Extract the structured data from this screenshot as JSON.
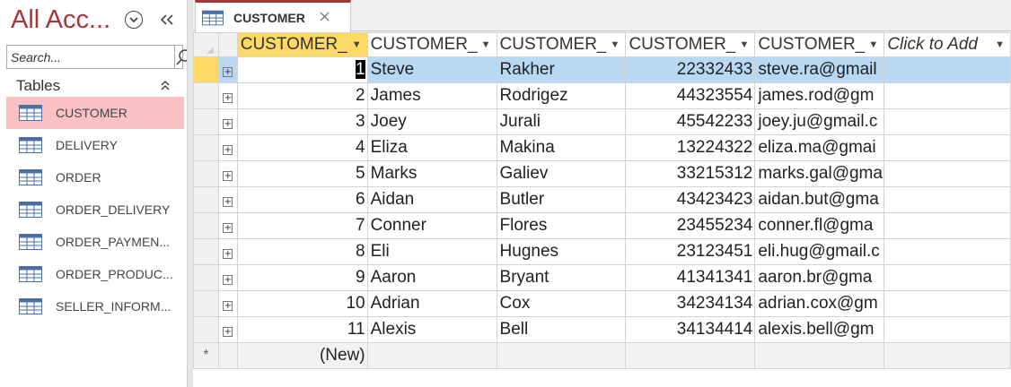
{
  "nav": {
    "title": "All Acc...",
    "search_placeholder": "Search...",
    "group_label": "Tables",
    "items": [
      {
        "label": "CUSTOMER",
        "selected": true
      },
      {
        "label": "DELIVERY",
        "selected": false
      },
      {
        "label": "ORDER",
        "selected": false
      },
      {
        "label": "ORDER_DELIVERY",
        "selected": false
      },
      {
        "label": "ORDER_PAYMEN...",
        "selected": false
      },
      {
        "label": "ORDER_PRODUC...",
        "selected": false
      },
      {
        "label": "SELLER_INFORM...",
        "selected": false
      }
    ]
  },
  "tab": {
    "label": "CUSTOMER",
    "icon": "table-icon"
  },
  "datasheet": {
    "headers": [
      "CUSTOMER_",
      "CUSTOMER_",
      "CUSTOMER_",
      "CUSTOMER_",
      "CUSTOMER_",
      "Click to Add"
    ],
    "rows": [
      {
        "id": "1",
        "first": "Steve",
        "last": "Rakher",
        "phone": "22332433",
        "email": "steve.ra@gmail"
      },
      {
        "id": "2",
        "first": "James",
        "last": "Rodrigez",
        "phone": "44323554",
        "email": "james.rod@gm"
      },
      {
        "id": "3",
        "first": "Joey",
        "last": "Jurali",
        "phone": "45542233",
        "email": "joey.ju@gmail.c"
      },
      {
        "id": "4",
        "first": "Eliza",
        "last": "Makina",
        "phone": "13224322",
        "email": "eliza.ma@gmai"
      },
      {
        "id": "5",
        "first": "Marks",
        "last": "Galiev",
        "phone": "33215312",
        "email": "marks.gal@gma"
      },
      {
        "id": "6",
        "first": "Aidan",
        "last": "Butler",
        "phone": "43423423",
        "email": "aidan.but@gma"
      },
      {
        "id": "7",
        "first": "Conner",
        "last": "Flores",
        "phone": "23455234",
        "email": "conner.fl@gma"
      },
      {
        "id": "8",
        "first": "Eli",
        "last": "Hugnes",
        "phone": "23123451",
        "email": "eli.hug@gmail.c"
      },
      {
        "id": "9",
        "first": "Aaron",
        "last": "Bryant",
        "phone": "41341341",
        "email": "aaron.br@gma"
      },
      {
        "id": "10",
        "first": "Adrian",
        "last": "Cox",
        "phone": "34234134",
        "email": "adrian.cox@gm"
      },
      {
        "id": "11",
        "first": "Alexis",
        "last": "Bell",
        "phone": "34134414",
        "email": "alexis.bell@gm"
      }
    ],
    "new_row_label": "(New)",
    "new_row_marker": "*",
    "expand_glyph": "+"
  },
  "colors": {
    "accent": "#a4373a",
    "selected_nav": "#f9c1c3",
    "active_row": "#b8d8f3",
    "selected_header": "#ffd966"
  }
}
